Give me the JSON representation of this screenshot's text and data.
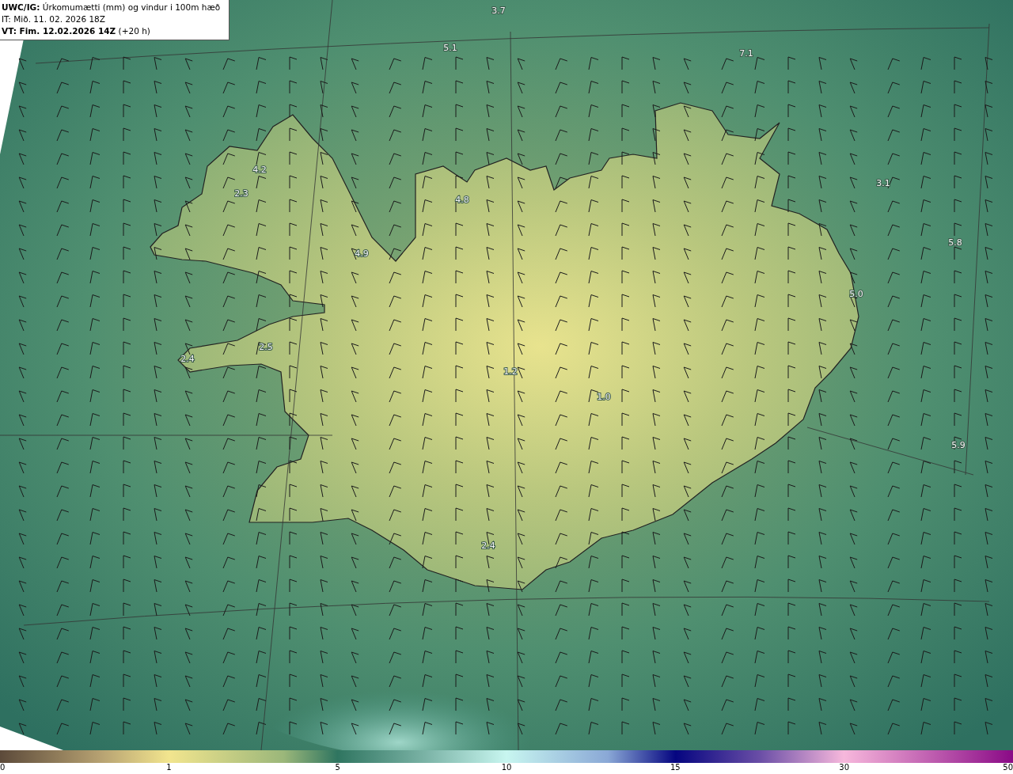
{
  "header": {
    "title": "**UWC/IG:** Úrkomumætti (mm) og vindur i 100m hæð",
    "issue_time": "IT: Mið. 11. 02. 2026 18Z",
    "valid_time": "**VT: Fim. 12.02.2026 14Z** (+20 h)"
  },
  "map_labels": [
    "3.7",
    "5.1",
    "7.1",
    "4.2",
    "2.3",
    "4.8",
    "3.1",
    "5.8",
    "4.9",
    "5.0",
    "2.5",
    "2.4",
    "1.2",
    "1.0",
    "5.9",
    "2.4"
  ],
  "colorbar": {
    "ticks": [
      "0",
      "1",
      "5",
      "10",
      "15",
      "30",
      "50"
    ]
  }
}
